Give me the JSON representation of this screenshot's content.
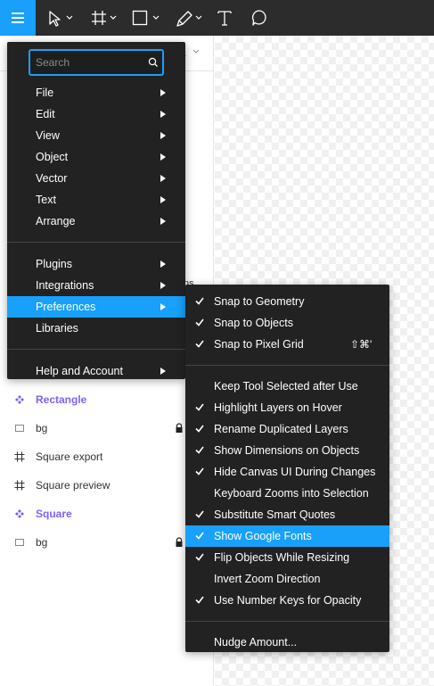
{
  "colors": {
    "accent": "#18a0fb",
    "menu_bg": "#222222",
    "toolbar_bg": "#2c2c2c",
    "component": "#7b61ff"
  },
  "toolbar": {
    "icons": [
      "hamburger-menu-icon",
      "move-tool-icon",
      "frame-tool-icon",
      "rectangle-tool-icon",
      "pen-tool-icon",
      "text-tool-icon",
      "comment-tool-icon"
    ]
  },
  "left_panel": {
    "page_stub": "1",
    "hidden_text": "ns",
    "layers": [
      {
        "label": "Rectangle",
        "icon": "component-icon",
        "kind": "component",
        "locked": false
      },
      {
        "label": "bg",
        "icon": "rectangle-icon",
        "kind": "layer",
        "locked": true
      },
      {
        "label": "Square export",
        "icon": "frame-icon",
        "kind": "frame",
        "locked": false
      },
      {
        "label": "Square preview",
        "icon": "frame-icon",
        "kind": "frame",
        "locked": false
      },
      {
        "label": "Square",
        "icon": "component-icon",
        "kind": "component",
        "locked": false
      },
      {
        "label": "bg",
        "icon": "rectangle-icon",
        "kind": "layer",
        "locked": true
      }
    ]
  },
  "main_menu": {
    "search_placeholder": "Search",
    "groups": [
      [
        {
          "label": "File",
          "submenu": true
        },
        {
          "label": "Edit",
          "submenu": true
        },
        {
          "label": "View",
          "submenu": true
        },
        {
          "label": "Object",
          "submenu": true
        },
        {
          "label": "Vector",
          "submenu": true
        },
        {
          "label": "Text",
          "submenu": true
        },
        {
          "label": "Arrange",
          "submenu": true
        }
      ],
      [
        {
          "label": "Plugins",
          "submenu": true
        },
        {
          "label": "Integrations",
          "submenu": true
        },
        {
          "label": "Preferences",
          "submenu": true,
          "active": true
        },
        {
          "label": "Libraries",
          "submenu": false
        }
      ],
      [
        {
          "label": "Help and Account",
          "submenu": true
        }
      ]
    ]
  },
  "preferences_menu": {
    "groups": [
      [
        {
          "label": "Snap to Geometry",
          "checked": true
        },
        {
          "label": "Snap to Objects",
          "checked": true
        },
        {
          "label": "Snap to Pixel Grid",
          "checked": true,
          "shortcut": "⇧⌘'"
        }
      ],
      [
        {
          "label": "Keep Tool Selected after Use",
          "checked": false
        },
        {
          "label": "Highlight Layers on Hover",
          "checked": true
        },
        {
          "label": "Rename Duplicated Layers",
          "checked": true
        },
        {
          "label": "Show Dimensions on Objects",
          "checked": true
        },
        {
          "label": "Hide Canvas UI During Changes",
          "checked": true
        },
        {
          "label": "Keyboard Zooms into Selection",
          "checked": false
        },
        {
          "label": "Substitute Smart Quotes",
          "checked": true
        },
        {
          "label": "Show Google Fonts",
          "checked": true,
          "active": true
        },
        {
          "label": "Flip Objects While Resizing",
          "checked": true
        },
        {
          "label": "Invert Zoom Direction",
          "checked": false
        },
        {
          "label": "Use Number Keys for Opacity",
          "checked": true
        }
      ],
      [
        {
          "label": "Nudge Amount...",
          "checked": false
        }
      ]
    ]
  }
}
